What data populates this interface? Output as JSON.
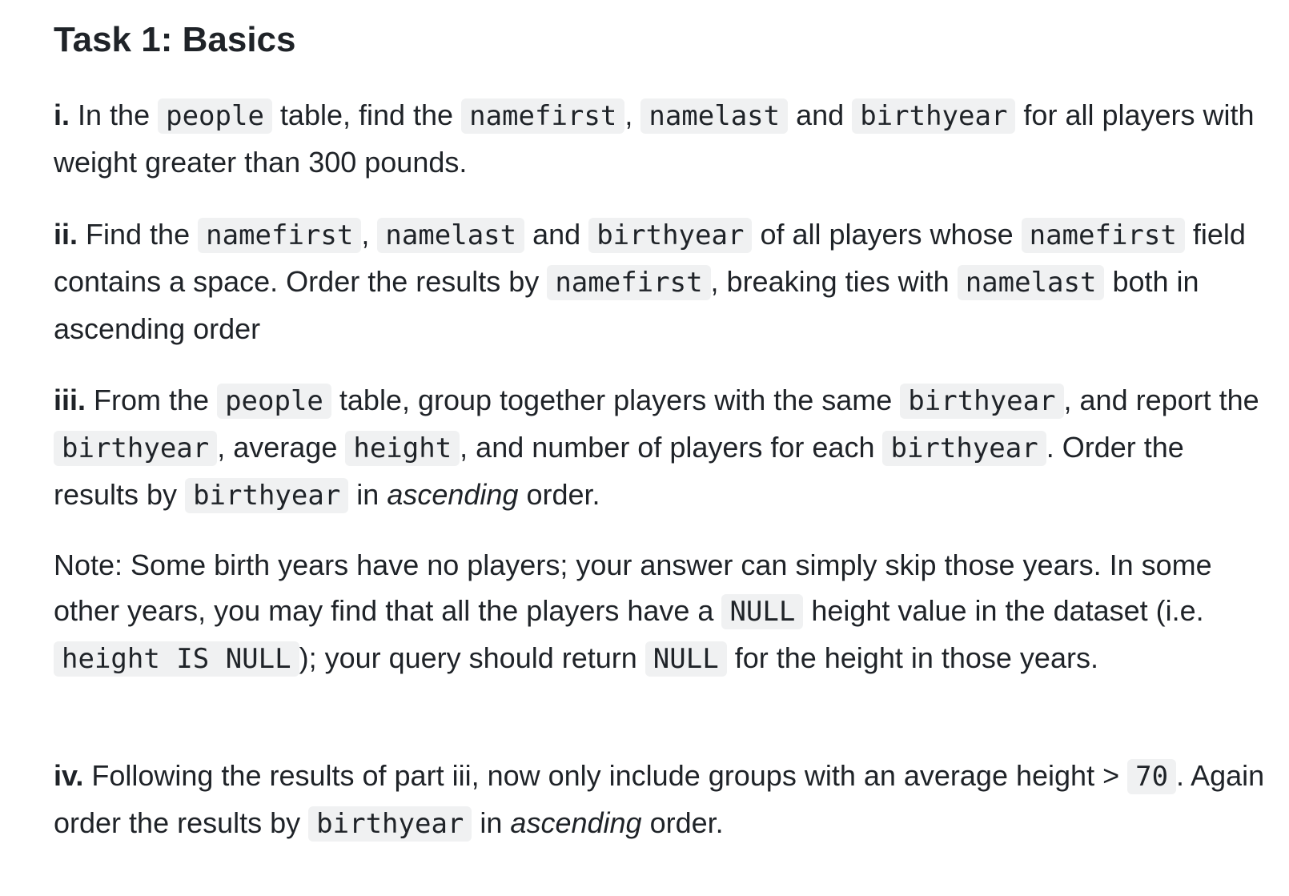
{
  "heading": "Task 1: Basics",
  "p1": {
    "num": "i.",
    "t1": " In the ",
    "c1": "people",
    "t2": " table, find the ",
    "c2": "namefirst",
    "t3": ", ",
    "c3": "namelast",
    "t4": " and ",
    "c4": "birthyear",
    "t5": " for all players with weight greater than 300 pounds."
  },
  "p2": {
    "num": "ii.",
    "t1": " Find the ",
    "c1": "namefirst",
    "t2": ", ",
    "c2": "namelast",
    "t3": " and ",
    "c3": "birthyear",
    "t4": " of all players whose ",
    "c4": "namefirst",
    "t5": " field contains a space. Order the results by ",
    "c5": "namefirst",
    "t6": ", breaking ties with ",
    "c6": "namelast",
    "t7": " both in ascending order"
  },
  "p3": {
    "num": "iii.",
    "t1": " From the ",
    "c1": "people",
    "t2": " table, group together players with the same ",
    "c2": "birthyear",
    "t3": ", and report the ",
    "c3": "birthyear",
    "t4": ", average ",
    "c4": "height",
    "t5": ", and number of players for each ",
    "c5": "birthyear",
    "t6": ". Order the results by ",
    "c6": "birthyear",
    "t7": " in ",
    "em1": "ascending",
    "t8": " order."
  },
  "p4": {
    "t1": "Note: Some birth years have no players; your answer can simply skip those years. In some other years, you may find that all the players have a ",
    "c1": "NULL",
    "t2": " height value in the dataset (i.e. ",
    "c2": "height IS NULL",
    "t3": "); your query should return ",
    "c3": "NULL",
    "t4": " for the height in those years."
  },
  "p5": {
    "num": "iv.",
    "t1": " Following the results of part iii, now only include groups with an average height > ",
    "c1": "70",
    "t2": ". Again order the results by ",
    "c2": "birthyear",
    "t3": " in ",
    "em1": "ascending",
    "t4": " order."
  }
}
